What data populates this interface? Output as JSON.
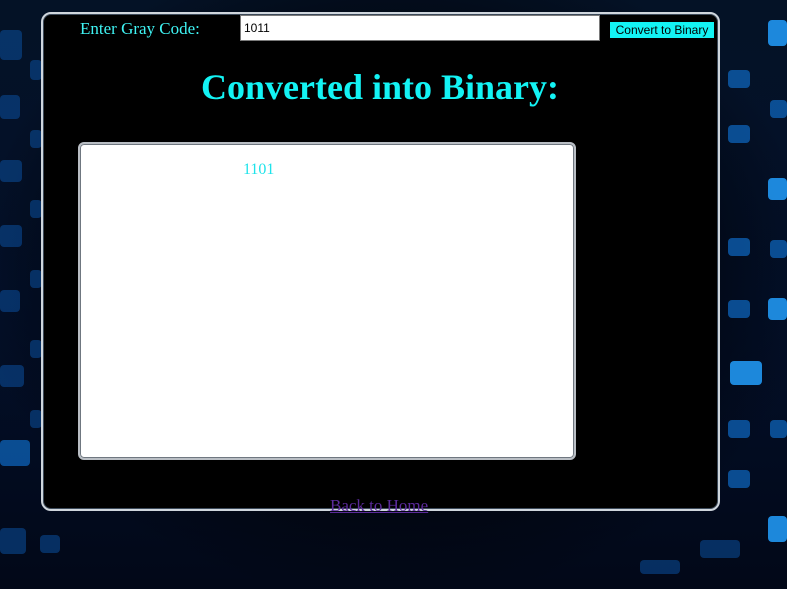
{
  "form": {
    "gray_label": "Enter Gray Code:",
    "gray_value": "1011",
    "convert_label": "Convert to Binary"
  },
  "result": {
    "heading": "Converted into Binary:",
    "binary_value": "1101"
  },
  "footer": {
    "back_link": "Back to Home"
  },
  "colors": {
    "accent": "#13f3f4",
    "link": "#5b2a9b",
    "background": "#02060f"
  }
}
